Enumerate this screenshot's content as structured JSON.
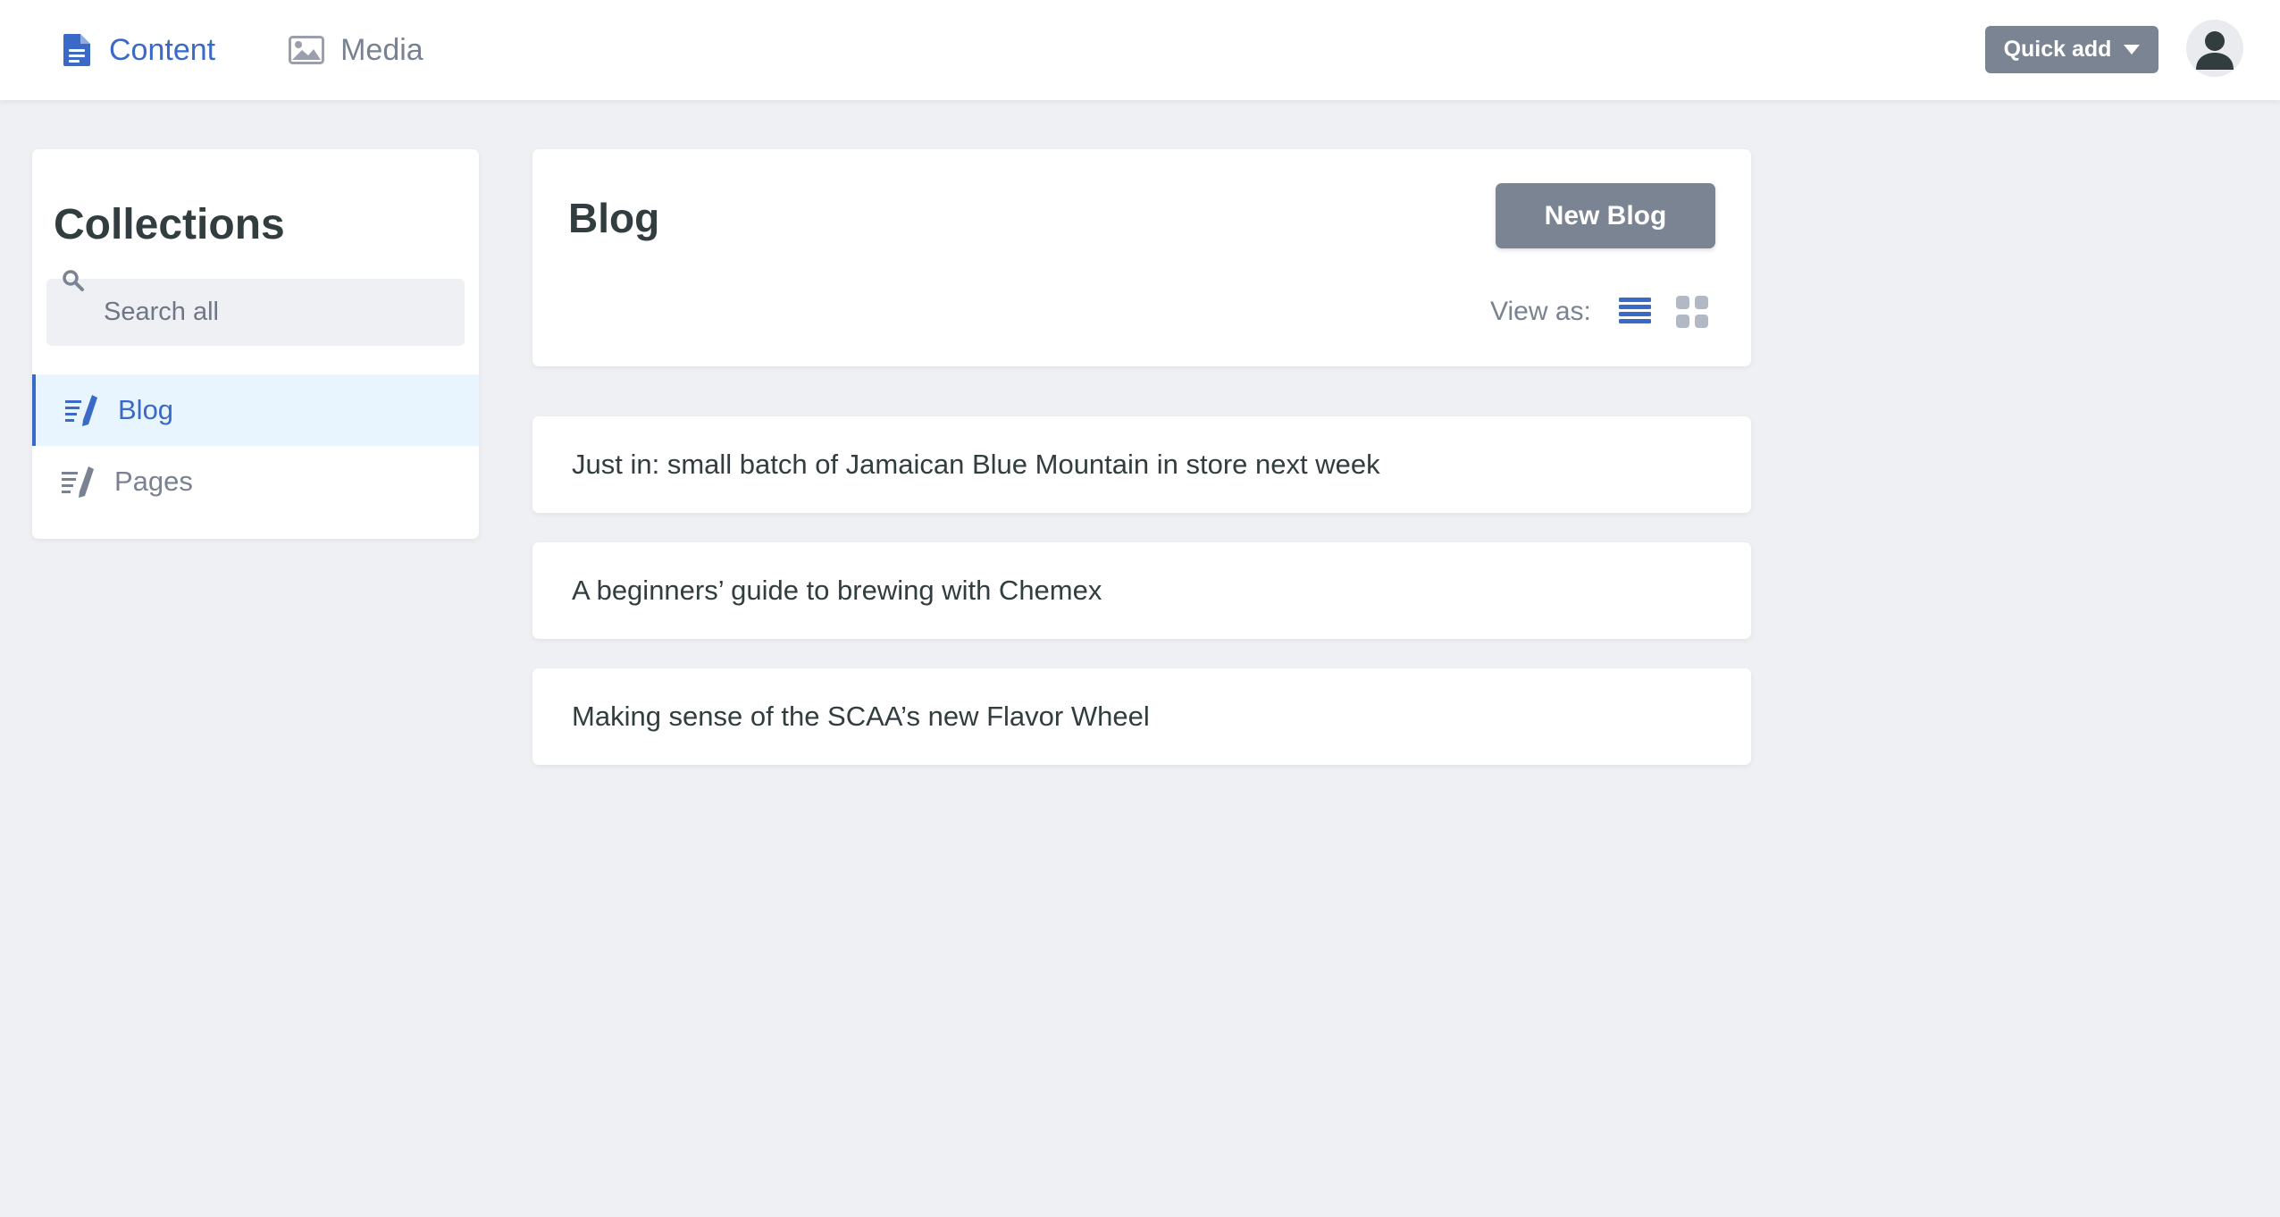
{
  "topnav": {
    "content_label": "Content",
    "media_label": "Media",
    "content_icon": "document-icon",
    "media_icon": "image-icon"
  },
  "header_actions": {
    "quick_add_label": "Quick add",
    "avatar_icon": "user-avatar-icon"
  },
  "sidebar": {
    "title": "Collections",
    "search_placeholder": "Search all",
    "search_value": "",
    "items": [
      {
        "label": "Blog",
        "active": true,
        "icon": "write-icon"
      },
      {
        "label": "Pages",
        "active": false,
        "icon": "write-icon"
      }
    ]
  },
  "main": {
    "collection_title": "Blog",
    "new_button_label": "New Blog",
    "view_as_label": "View as:",
    "view_options": [
      {
        "name": "list-view-icon",
        "active": true
      },
      {
        "name": "grid-view-icon",
        "active": false
      }
    ],
    "entries": [
      "Just in: small batch of Jamaican Blue Mountain in store next week",
      "A beginners’ guide to brewing with Chemex",
      "Making sense of the SCAA’s new Flavor Wheel"
    ]
  },
  "colors": {
    "accent": "#3a69c7",
    "background": "#eff0f4",
    "button": "#7b8492",
    "active_item_bg": "#e8f5fe",
    "text": "#313d3e",
    "muted": "#798291"
  }
}
